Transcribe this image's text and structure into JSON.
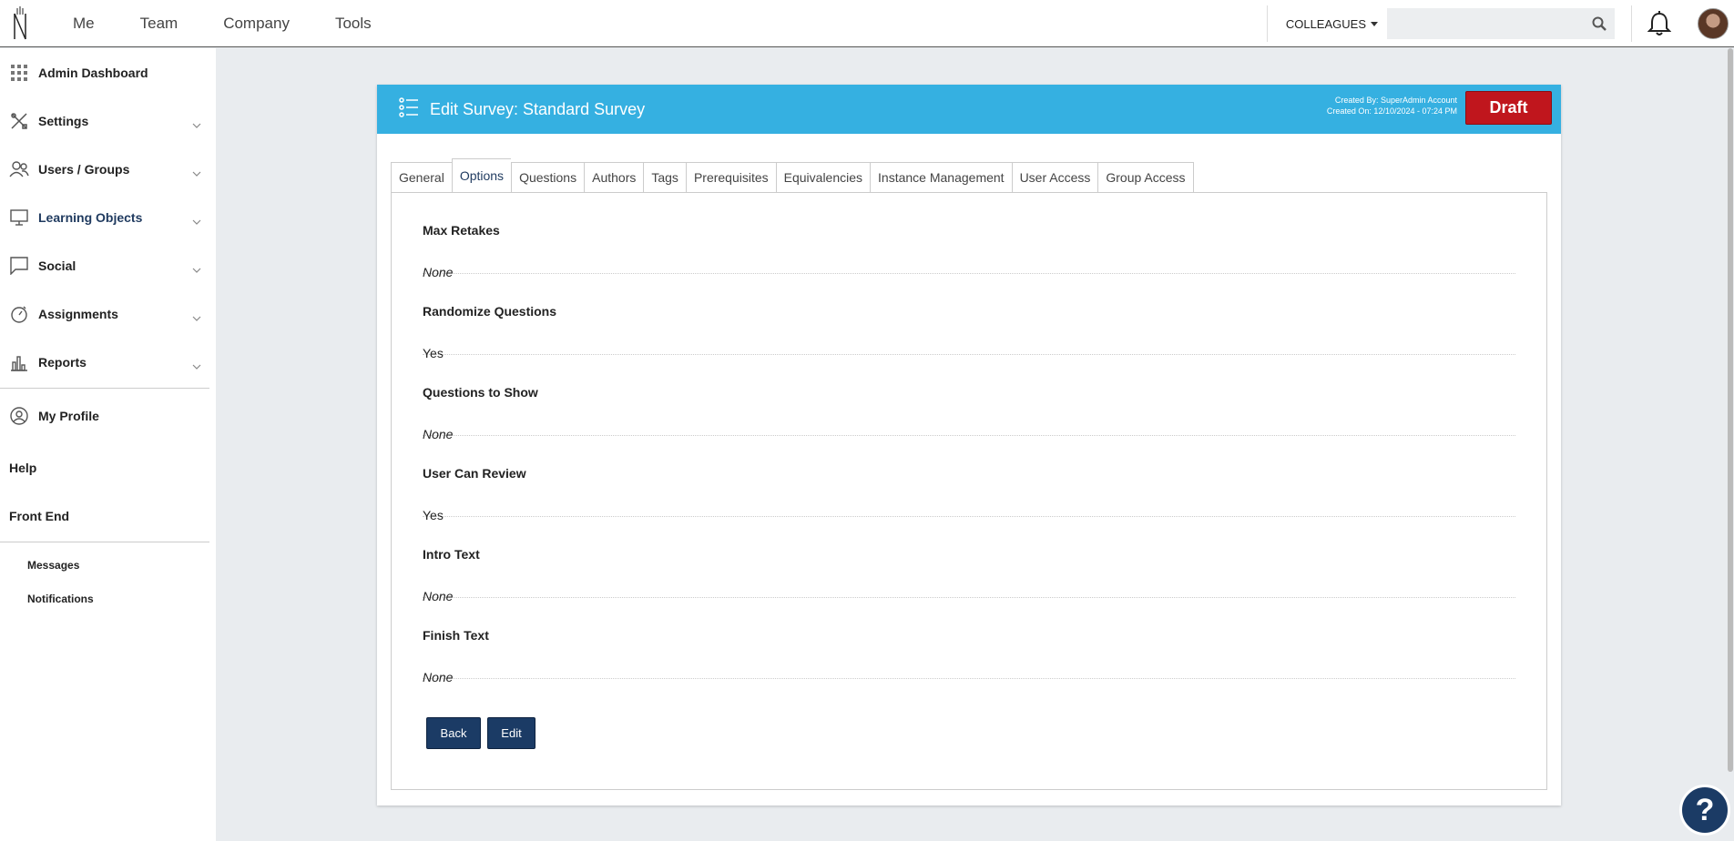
{
  "topbar": {
    "nav": [
      "Me",
      "Team",
      "Company",
      "Tools"
    ],
    "colleagues_label": "COLLEAGUES",
    "search_placeholder": "",
    "search_value": ""
  },
  "sidebar": {
    "items": [
      {
        "label": "Admin Dashboard",
        "icon": "grid-icon",
        "has_chevron": false
      },
      {
        "label": "Settings",
        "icon": "tools-icon",
        "has_chevron": true
      },
      {
        "label": "Users / Groups",
        "icon": "users-icon",
        "has_chevron": true
      },
      {
        "label": "Learning Objects",
        "icon": "monitor-icon",
        "has_chevron": true,
        "active": true
      },
      {
        "label": "Social",
        "icon": "chat-icon",
        "has_chevron": true
      },
      {
        "label": "Assignments",
        "icon": "stopwatch-icon",
        "has_chevron": true
      },
      {
        "label": "Reports",
        "icon": "bar-chart-icon",
        "has_chevron": true
      }
    ],
    "profile": "My Profile",
    "help": "Help",
    "front_end": "Front End",
    "messages": "Messages",
    "notifications": "Notifications"
  },
  "card": {
    "title": "Edit Survey: Standard Survey",
    "created_by": "Created By: SuperAdmin Account",
    "created_on": "Created On: 12/10/2024 - 07:24 PM",
    "status": "Draft",
    "status_color": "#c0161d",
    "header_color": "#35b0e1"
  },
  "tabs": [
    "General",
    "Options",
    "Questions",
    "Authors",
    "Tags",
    "Prerequisites",
    "Equivalencies",
    "Instance Management",
    "User Access",
    "Group Access"
  ],
  "active_tab": "Options",
  "options": [
    {
      "name": "Max Retakes",
      "value": "None",
      "italic": true
    },
    {
      "name": "Randomize Questions",
      "value": "Yes",
      "italic": false
    },
    {
      "name": "Questions to Show",
      "value": "None",
      "italic": true
    },
    {
      "name": "User Can Review",
      "value": "Yes",
      "italic": false
    },
    {
      "name": "Intro Text",
      "value": "None",
      "italic": true
    },
    {
      "name": "Finish Text",
      "value": "None",
      "italic": true
    }
  ],
  "buttons": {
    "back": "Back",
    "edit": "Edit"
  },
  "help_button": "?"
}
